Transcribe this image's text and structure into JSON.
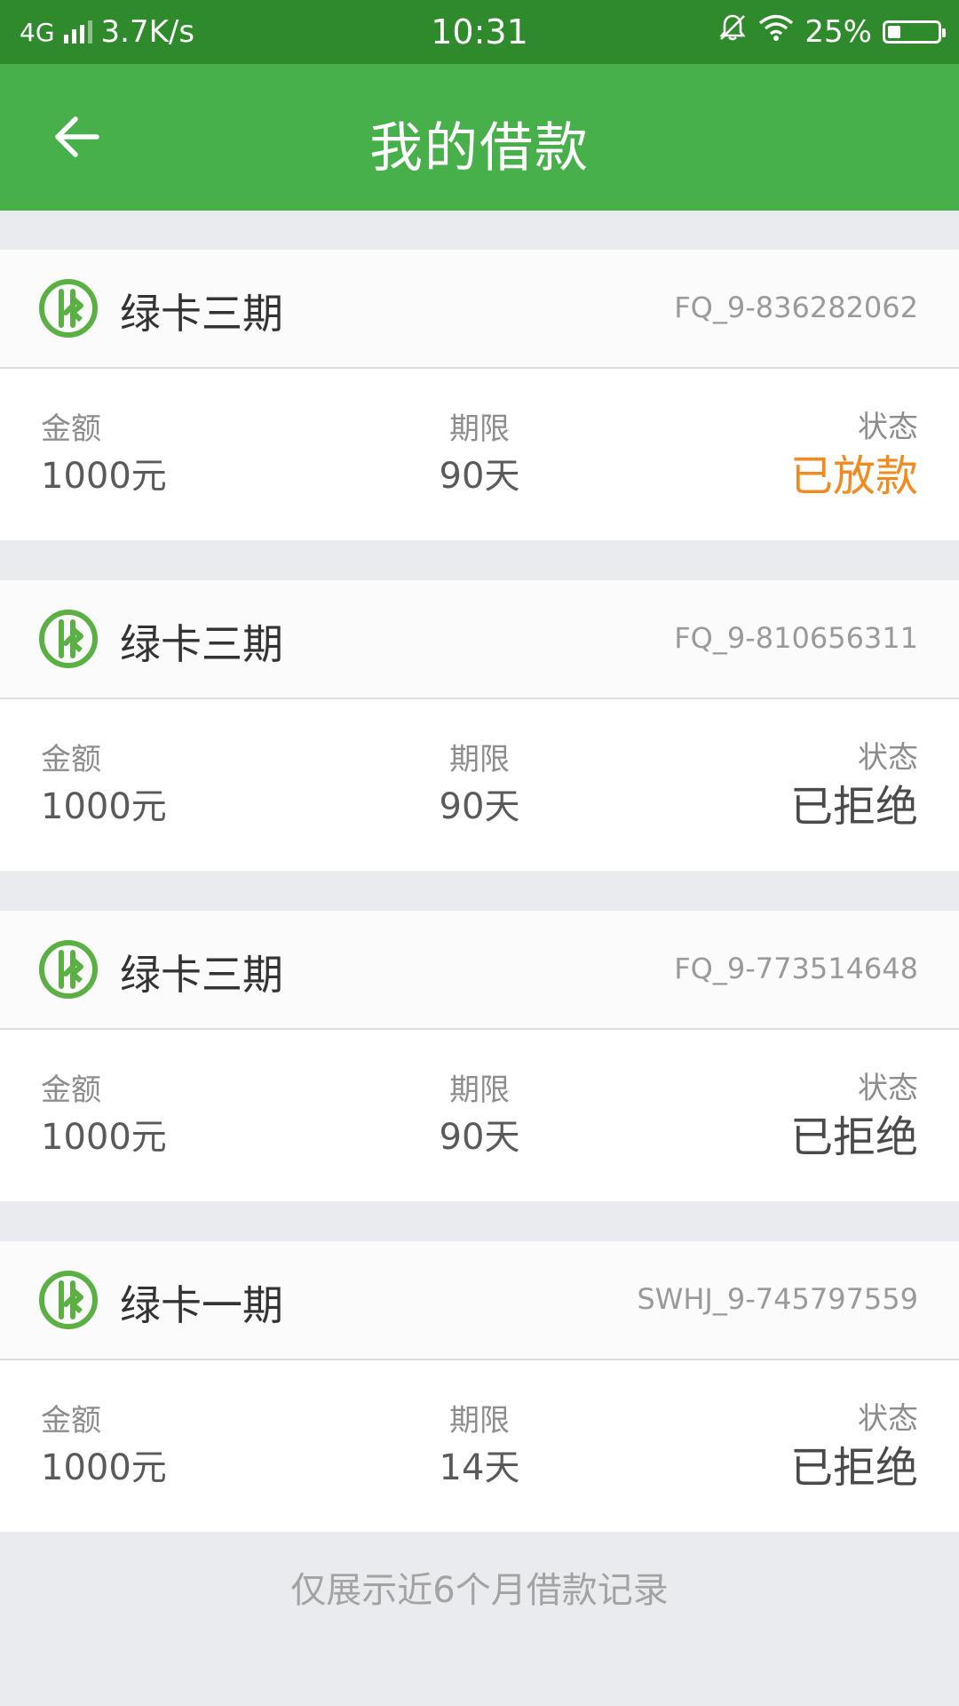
{
  "status_bar": {
    "network": "4G",
    "speed": "3.7K/s",
    "time": "10:31",
    "battery": "25%",
    "battery_level": 0.25
  },
  "app_bar": {
    "title": "我的借款"
  },
  "loans": [
    {
      "product": "绿卡三期",
      "order_no": "FQ_9-836282062",
      "amount_label": "金额",
      "amount": "1000元",
      "term_label": "期限",
      "term": "90天",
      "status_label": "状态",
      "status": "已放款",
      "status_color": "#f28a1e"
    },
    {
      "product": "绿卡三期",
      "order_no": "FQ_9-810656311",
      "amount_label": "金额",
      "amount": "1000元",
      "term_label": "期限",
      "term": "90天",
      "status_label": "状态",
      "status": "已拒绝",
      "status_color": "#4a4a4a"
    },
    {
      "product": "绿卡三期",
      "order_no": "FQ_9-773514648",
      "amount_label": "金额",
      "amount": "1000元",
      "term_label": "期限",
      "term": "90天",
      "status_label": "状态",
      "status": "已拒绝",
      "status_color": "#4a4a4a"
    },
    {
      "product": "绿卡一期",
      "order_no": "SWHJ_9-745797559",
      "amount_label": "金额",
      "amount": "1000元",
      "term_label": "期限",
      "term": "14天",
      "status_label": "状态",
      "status": "已拒绝",
      "status_color": "#4a4a4a"
    }
  ],
  "footer_note": "仅展示近6个月借款记录",
  "colors": {
    "status_bar": "#2e8a2b",
    "app_bar": "#47b04b",
    "logo_green": "#5bb043",
    "status_disbursed": "#f28a1e"
  }
}
